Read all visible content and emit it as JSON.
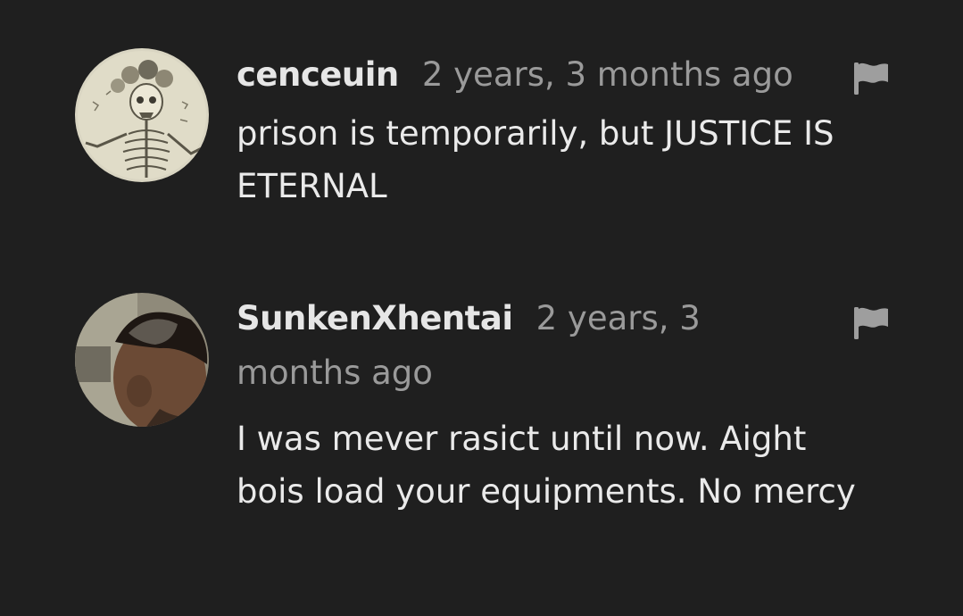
{
  "comments": [
    {
      "username": "cenceuin",
      "time": "2 years, 3 months ago",
      "text": "prison is temporarily, but JUSTICE IS ETERNAL",
      "avatar_icon": "skeleton-avatar",
      "flag_icon": "flag-icon"
    },
    {
      "username": "SunkenXhentai",
      "time": "2 years, 3 months ago",
      "text": "I was mever rasict until now. Aight bois load your equipments. No mercy",
      "avatar_icon": "profile-photo-avatar",
      "flag_icon": "flag-icon"
    }
  ],
  "colors": {
    "background": "#1f1f1f",
    "username": "#e6e6e6",
    "timestamp": "#9a9a9a",
    "text": "#eaeaea",
    "flag": "#9e9e9e"
  }
}
